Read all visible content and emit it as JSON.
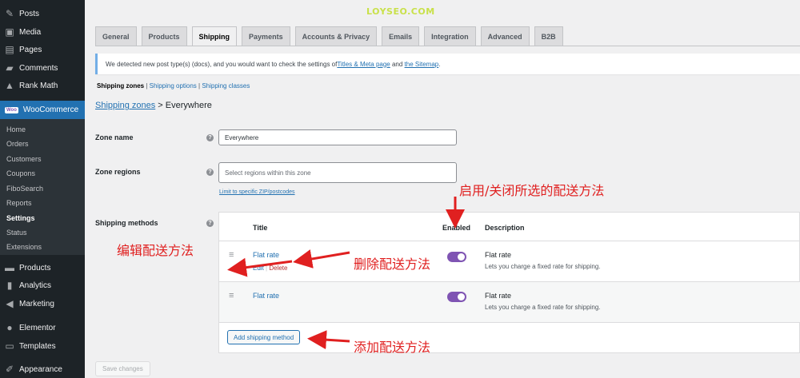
{
  "watermark": "LOYSEO.COM",
  "sidebar": {
    "items": [
      {
        "label": "Posts",
        "icon": "pin-icon",
        "glyph": "✎"
      },
      {
        "label": "Media",
        "icon": "media-icon",
        "glyph": "▣"
      },
      {
        "label": "Pages",
        "icon": "pages-icon",
        "glyph": "▤"
      },
      {
        "label": "Comments",
        "icon": "comments-icon",
        "glyph": "▰"
      },
      {
        "label": "Rank Math",
        "icon": "rank-math-icon",
        "glyph": "▲"
      },
      {
        "label": "WooCommerce",
        "icon": "woocommerce-icon",
        "glyph": "Woo"
      },
      {
        "label": "Products",
        "icon": "products-icon",
        "glyph": "▬"
      },
      {
        "label": "Analytics",
        "icon": "analytics-icon",
        "glyph": "▮"
      },
      {
        "label": "Marketing",
        "icon": "marketing-icon",
        "glyph": "◀"
      },
      {
        "label": "Elementor",
        "icon": "elementor-icon",
        "glyph": "●"
      },
      {
        "label": "Templates",
        "icon": "templates-icon",
        "glyph": "▭"
      },
      {
        "label": "Appearance",
        "icon": "appearance-icon",
        "glyph": "✐"
      }
    ],
    "submenu": [
      "Home",
      "Orders",
      "Customers",
      "Coupons",
      "FiboSearch",
      "Reports",
      "Settings",
      "Status",
      "Extensions"
    ]
  },
  "tabs": [
    "General",
    "Products",
    "Shipping",
    "Payments",
    "Accounts & Privacy",
    "Emails",
    "Integration",
    "Advanced",
    "B2B"
  ],
  "notice": {
    "text_before": "We detected new post type(s) (docs), and you would want to check the settings of ",
    "link1": "Titles & Meta page",
    "text_mid": " and ",
    "link2": "the Sitemap",
    "text_after": "."
  },
  "subnav": {
    "current": "Shipping zones",
    "sep1": " | ",
    "link1": "Shipping options",
    "sep2": " | ",
    "link2": "Shipping classes"
  },
  "heading": {
    "link": "Shipping zones",
    "rest": " > Everywhere"
  },
  "zone_name": {
    "label": "Zone name",
    "value": "Everywhere"
  },
  "zone_regions": {
    "label": "Zone regions",
    "placeholder": "Select regions within this zone",
    "zip_link": "Limit to specific ZIP/postcodes"
  },
  "shipping_methods": {
    "label": "Shipping methods",
    "headers": {
      "title": "Title",
      "enabled": "Enabled",
      "description": "Description"
    },
    "rows": [
      {
        "title": "Flat rate",
        "edit": "Edit",
        "sep": " | ",
        "delete": "Delete",
        "desc_title": "Flat rate",
        "desc": "Lets you charge a fixed rate for shipping.",
        "enabled": true
      },
      {
        "title": "Flat rate",
        "desc_title": "Flat rate",
        "desc": "Lets you charge a fixed rate for shipping.",
        "enabled": true
      }
    ],
    "add_button": "Add shipping method"
  },
  "save_button": "Save changes",
  "help_glyph": "?",
  "drag_glyph": "≡",
  "annotations": {
    "toggle": "启用/关闭所选的配送方法",
    "edit": "编辑配送方法",
    "delete": "删除配送方法",
    "add": "添加配送方法"
  },
  "colors": {
    "accent": "#2271b1",
    "sidebar": "#1d2327",
    "active_menu": "#2271b1",
    "toggle": "#7f54b3",
    "annotation": "#e02020"
  }
}
